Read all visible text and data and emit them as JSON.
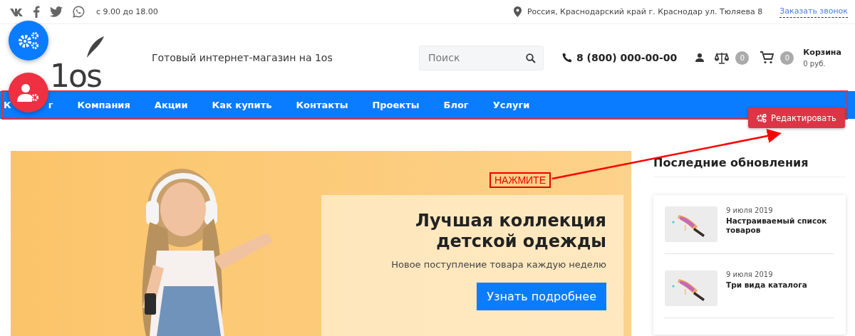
{
  "topbar": {
    "hours": "с 9.00 до 18.00",
    "address": "Россия, Краснодарский край г. Краснодар ул. Тюляева 8",
    "callback_link": "Заказать звонок"
  },
  "header": {
    "logo_text": "1os",
    "tagline": "Готовый интернет-магазин на 1os",
    "search": {
      "placeholder": "Поиск"
    },
    "phone": "8 (800) 000-00-00",
    "compare_count": "0",
    "cart_count": "0",
    "cart_title": "Корзина",
    "cart_sum": "0 руб."
  },
  "nav": {
    "first_item_parts": [
      "К",
      "г"
    ],
    "items": [
      "Компания",
      "Акции",
      "Как купить",
      "Контакты",
      "Проекты",
      "Блог",
      "Услуги"
    ]
  },
  "edit_button": "Редактировать",
  "hero": {
    "annotation": "НАЖМИТЕ",
    "title": "Лучшая коллекция детской одежды",
    "subtitle": "Новое поступление товара каждую неделю",
    "button": "Узнать подробнее"
  },
  "updates": {
    "title": "Последние обновления",
    "items": [
      {
        "date": "9 июля 2019",
        "title": "Настраиваемый список товаров"
      },
      {
        "date": "9 июля 2019",
        "title": "Три вида каталога"
      }
    ]
  }
}
